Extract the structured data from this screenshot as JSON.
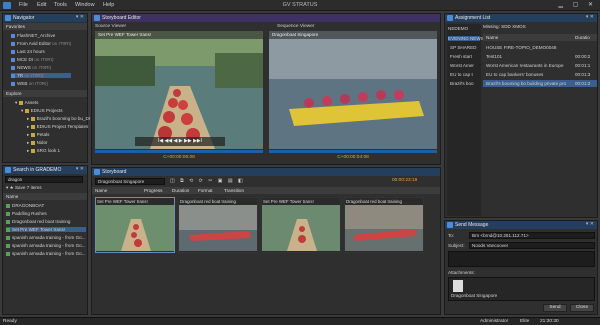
{
  "app": {
    "menu": [
      "File",
      "Edit",
      "Tools",
      "Window",
      "Help"
    ],
    "title": "GV STRATUS"
  },
  "navigator": {
    "title": "Navigator",
    "favorites_label": "Favorites",
    "favorites": [
      {
        "label": "FlashNET_Archive",
        "suffix": ""
      },
      {
        "label": "From Avid Editor",
        "suffix": "on IT0RI)"
      },
      {
        "label": "Last 24 hours",
        "suffix": ""
      },
      {
        "label": "MCE DI",
        "suffix": "on IT0RI)"
      },
      {
        "label": "NEWS",
        "suffix": "on IT0RI)"
      },
      {
        "label": "TR",
        "suffix": "on IT0RI)"
      },
      {
        "label": "WEB",
        "suffix": "on IT0RI)"
      }
    ],
    "explore_label": "Explore",
    "explore": [
      {
        "label": "Assets",
        "indent": 1
      },
      {
        "label": "EDIUS Projects",
        "indent": 2
      },
      {
        "label": "Brazil's booming bo bu_DI",
        "indent": 3
      },
      {
        "label": "EDIUS Project Templates",
        "indent": 3
      },
      {
        "label": "Petals",
        "indent": 3
      },
      {
        "label": "Nidor",
        "indent": 3
      },
      {
        "label": "SRG look 1",
        "indent": 3
      }
    ]
  },
  "search": {
    "title": "Search in GRADEMO",
    "query": "dragon",
    "save_label": "Save",
    "count_label": "7 items",
    "column": "Name",
    "results": [
      "DRAGONBOAT",
      "Paddling Rushes",
      "Dragonboat red boat training",
      "Set Pre WEF Tower trans!",
      "spanish armada training - from Go...",
      "spanish armada training - from Go...",
      "spanish armada training - from Go..."
    ]
  },
  "storyboard_editor": {
    "title": "Storyboard Editor"
  },
  "source_viewer": {
    "title": "Source Viewer",
    "clip": "Set Pre WEF Tower trans!",
    "timecode": "C+00:00:06:08",
    "controls": "I◀ ◀◀ ◀ ▶ ▶▶ ▶▶I"
  },
  "sequence_viewer": {
    "title": "Sequence Viewer",
    "clip": "Dragonboat Singapore",
    "timecode": "C+00:00:04:08"
  },
  "storyboard": {
    "title": "Storyboard",
    "sequence": "Dragonboat Singapore",
    "duration": "00:00:23:19",
    "columns": [
      "Name",
      "Progress",
      "Duration",
      "Format",
      "Transition"
    ],
    "clips": [
      "Set Pre WEF Tower trans!",
      "Dragonboat red boat training",
      "Set Pre WEF Tower trans!",
      "Dragonboat red boat training"
    ]
  },
  "assignment": {
    "title": "Assignment List",
    "filter": "Missing:",
    "sdd": "SDD",
    "xmos": "XMOS",
    "columns": [
      "Name",
      "Duratio"
    ],
    "items": [
      {
        "name": "HOUSE FIRE-TOPIO_DEMO0048",
        "dur": ""
      },
      {
        "name": "Test101",
        "dur": "00:00:2"
      },
      {
        "name": "Worst American restaurants in Europe",
        "dur": "00:01:1"
      },
      {
        "name": "EU to cap bankers' bonuses",
        "dur": "00:01:3"
      },
      {
        "name": "Brazil's booming bo building private pro",
        "dur": "00:01:2"
      }
    ],
    "left_header": "NEDEMO",
    "left_items": [
      "EVENING NEWS",
      "SP SHARED",
      "Fresh start",
      "Worst Amer",
      "EU to cap t",
      "Brazil's boo"
    ]
  },
  "send_message": {
    "title": "Send Message",
    "to_label": "To:",
    "to_value": "Brn <brnd@10.251.112.71>",
    "subject_label": "Subject:",
    "subject_value": "Noods Vancoover",
    "attachments_label": "Attachments:",
    "attachment": "Dragonboat Singapore",
    "send": "Send",
    "close": "Close"
  },
  "status": {
    "left": "Ready",
    "user": "Administrator",
    "elite": "Elite",
    "time": "21:30:30"
  }
}
